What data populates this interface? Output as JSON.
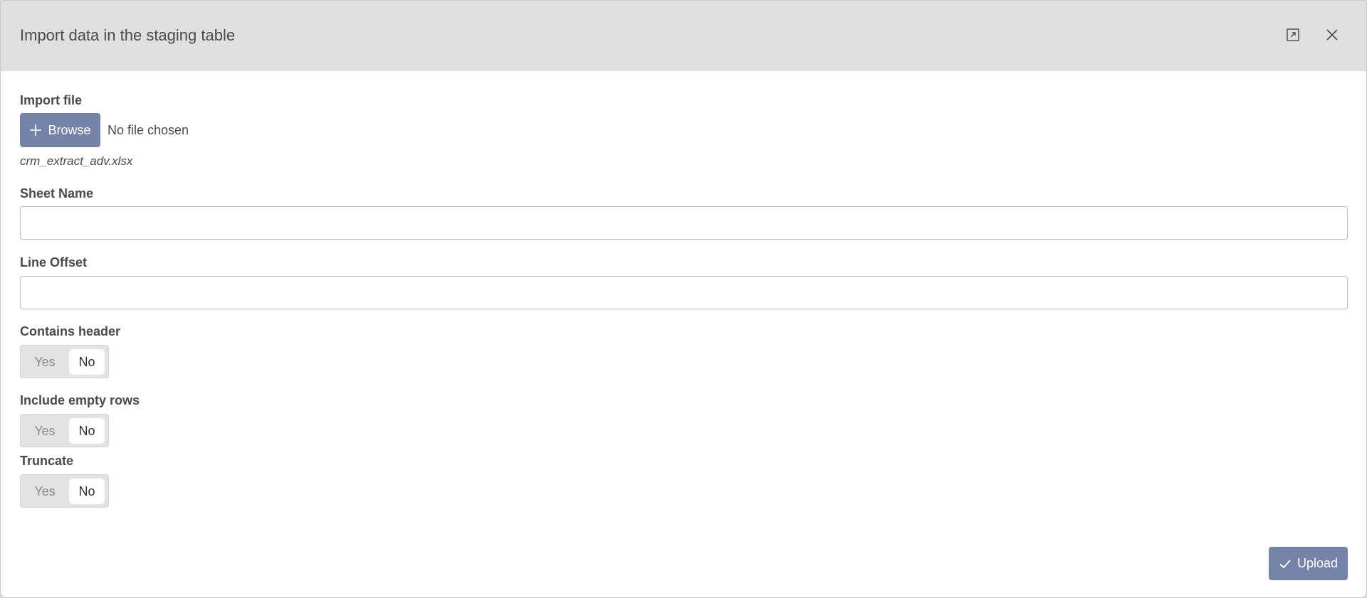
{
  "dialog": {
    "title": "Import data in the staging table",
    "maximize_icon": "maximize-icon",
    "close_icon": "close-icon"
  },
  "import_file": {
    "label": "Import file",
    "browse_label": "Browse",
    "browse_icon": "plus-icon",
    "no_file_text": "No file chosen",
    "current_file": "crm_extract_adv.xlsx"
  },
  "sheet_name": {
    "label": "Sheet Name",
    "value": ""
  },
  "line_offset": {
    "label": "Line Offset",
    "value": ""
  },
  "toggles": [
    {
      "label": "Contains header",
      "yes": "Yes",
      "no": "No",
      "selected": "No"
    },
    {
      "label": "Include empty rows",
      "yes": "Yes",
      "no": "No",
      "selected": "No"
    },
    {
      "label": "Truncate",
      "yes": "Yes",
      "no": "No",
      "selected": "No"
    }
  ],
  "footer": {
    "upload_label": "Upload",
    "upload_icon": "check-icon"
  },
  "colors": {
    "header_bg": "#e0e0e0",
    "button_bg": "#7683a8"
  }
}
